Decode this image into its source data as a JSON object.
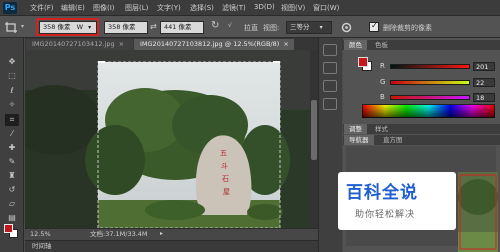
{
  "app": {
    "logo": "Ps",
    "menu": [
      "文件(F)",
      "编辑(E)",
      "图像(I)",
      "图层(L)",
      "文字(Y)",
      "选择(S)",
      "滤镜(T)",
      "3D(D)",
      "视图(V)",
      "窗口(W)"
    ]
  },
  "options_bar": {
    "crop_icon": "crop-icon",
    "width_value": "358 像素",
    "width_unit_arrow": "W",
    "height_value": "358 像素",
    "swap_symbol": "⇄",
    "third_value": "441 像素",
    "rotate_label": "↻",
    "straighten_label": "拉直",
    "view_label": "视图:",
    "view_value": "三等分",
    "delete_pixels_label": "删除裁剪的像素"
  },
  "tabs": [
    {
      "label": "IMG20140727103412.jpg",
      "close": "×",
      "active": false
    },
    {
      "label": "IMG20140727103812.jpg @ 12.5%(RGB/8)",
      "close": "×",
      "active": true
    }
  ],
  "status": {
    "zoom": "12.5%",
    "doc_info": "文档:37.1M/33.4M",
    "timeline": "时间轴"
  },
  "color_panel": {
    "tabs": [
      "颜色",
      "色板"
    ],
    "r_label": "R",
    "g_label": "G",
    "b_label": "B",
    "r_value": "201",
    "g_value": "22",
    "b_value": "18",
    "fg_color": "#c9161a"
  },
  "adjust_panel": {
    "tabs": [
      "调整",
      "样式"
    ]
  },
  "navigator_panel": {
    "tabs": [
      "导航器",
      "直方图"
    ]
  },
  "watermark": {
    "title": "百科全说",
    "subtitle": "助你轻松解决"
  }
}
